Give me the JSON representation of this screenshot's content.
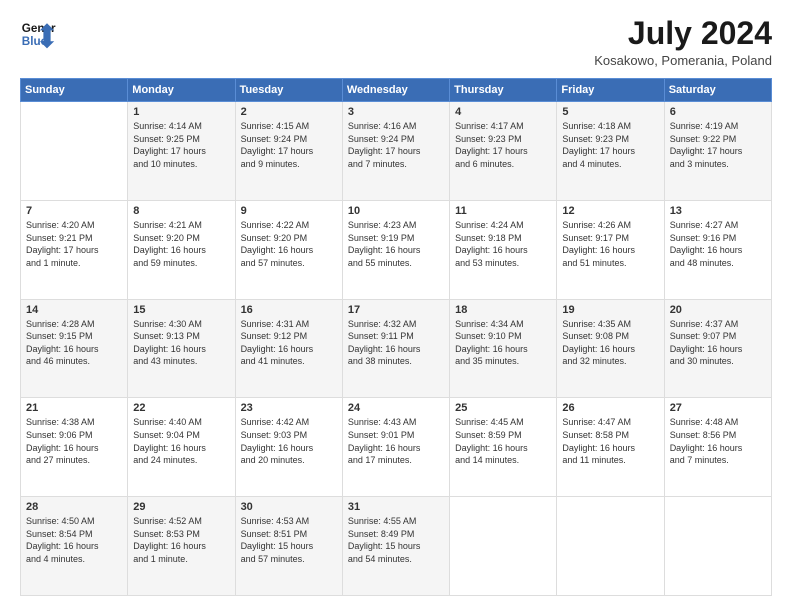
{
  "header": {
    "logo_line1": "General",
    "logo_line2": "Blue",
    "month_title": "July 2024",
    "location": "Kosakowo, Pomerania, Poland"
  },
  "weekdays": [
    "Sunday",
    "Monday",
    "Tuesday",
    "Wednesday",
    "Thursday",
    "Friday",
    "Saturday"
  ],
  "weeks": [
    [
      {
        "day": "",
        "text": ""
      },
      {
        "day": "1",
        "text": "Sunrise: 4:14 AM\nSunset: 9:25 PM\nDaylight: 17 hours\nand 10 minutes."
      },
      {
        "day": "2",
        "text": "Sunrise: 4:15 AM\nSunset: 9:24 PM\nDaylight: 17 hours\nand 9 minutes."
      },
      {
        "day": "3",
        "text": "Sunrise: 4:16 AM\nSunset: 9:24 PM\nDaylight: 17 hours\nand 7 minutes."
      },
      {
        "day": "4",
        "text": "Sunrise: 4:17 AM\nSunset: 9:23 PM\nDaylight: 17 hours\nand 6 minutes."
      },
      {
        "day": "5",
        "text": "Sunrise: 4:18 AM\nSunset: 9:23 PM\nDaylight: 17 hours\nand 4 minutes."
      },
      {
        "day": "6",
        "text": "Sunrise: 4:19 AM\nSunset: 9:22 PM\nDaylight: 17 hours\nand 3 minutes."
      }
    ],
    [
      {
        "day": "7",
        "text": "Sunrise: 4:20 AM\nSunset: 9:21 PM\nDaylight: 17 hours\nand 1 minute."
      },
      {
        "day": "8",
        "text": "Sunrise: 4:21 AM\nSunset: 9:20 PM\nDaylight: 16 hours\nand 59 minutes."
      },
      {
        "day": "9",
        "text": "Sunrise: 4:22 AM\nSunset: 9:20 PM\nDaylight: 16 hours\nand 57 minutes."
      },
      {
        "day": "10",
        "text": "Sunrise: 4:23 AM\nSunset: 9:19 PM\nDaylight: 16 hours\nand 55 minutes."
      },
      {
        "day": "11",
        "text": "Sunrise: 4:24 AM\nSunset: 9:18 PM\nDaylight: 16 hours\nand 53 minutes."
      },
      {
        "day": "12",
        "text": "Sunrise: 4:26 AM\nSunset: 9:17 PM\nDaylight: 16 hours\nand 51 minutes."
      },
      {
        "day": "13",
        "text": "Sunrise: 4:27 AM\nSunset: 9:16 PM\nDaylight: 16 hours\nand 48 minutes."
      }
    ],
    [
      {
        "day": "14",
        "text": "Sunrise: 4:28 AM\nSunset: 9:15 PM\nDaylight: 16 hours\nand 46 minutes."
      },
      {
        "day": "15",
        "text": "Sunrise: 4:30 AM\nSunset: 9:13 PM\nDaylight: 16 hours\nand 43 minutes."
      },
      {
        "day": "16",
        "text": "Sunrise: 4:31 AM\nSunset: 9:12 PM\nDaylight: 16 hours\nand 41 minutes."
      },
      {
        "day": "17",
        "text": "Sunrise: 4:32 AM\nSunset: 9:11 PM\nDaylight: 16 hours\nand 38 minutes."
      },
      {
        "day": "18",
        "text": "Sunrise: 4:34 AM\nSunset: 9:10 PM\nDaylight: 16 hours\nand 35 minutes."
      },
      {
        "day": "19",
        "text": "Sunrise: 4:35 AM\nSunset: 9:08 PM\nDaylight: 16 hours\nand 32 minutes."
      },
      {
        "day": "20",
        "text": "Sunrise: 4:37 AM\nSunset: 9:07 PM\nDaylight: 16 hours\nand 30 minutes."
      }
    ],
    [
      {
        "day": "21",
        "text": "Sunrise: 4:38 AM\nSunset: 9:06 PM\nDaylight: 16 hours\nand 27 minutes."
      },
      {
        "day": "22",
        "text": "Sunrise: 4:40 AM\nSunset: 9:04 PM\nDaylight: 16 hours\nand 24 minutes."
      },
      {
        "day": "23",
        "text": "Sunrise: 4:42 AM\nSunset: 9:03 PM\nDaylight: 16 hours\nand 20 minutes."
      },
      {
        "day": "24",
        "text": "Sunrise: 4:43 AM\nSunset: 9:01 PM\nDaylight: 16 hours\nand 17 minutes."
      },
      {
        "day": "25",
        "text": "Sunrise: 4:45 AM\nSunset: 8:59 PM\nDaylight: 16 hours\nand 14 minutes."
      },
      {
        "day": "26",
        "text": "Sunrise: 4:47 AM\nSunset: 8:58 PM\nDaylight: 16 hours\nand 11 minutes."
      },
      {
        "day": "27",
        "text": "Sunrise: 4:48 AM\nSunset: 8:56 PM\nDaylight: 16 hours\nand 7 minutes."
      }
    ],
    [
      {
        "day": "28",
        "text": "Sunrise: 4:50 AM\nSunset: 8:54 PM\nDaylight: 16 hours\nand 4 minutes."
      },
      {
        "day": "29",
        "text": "Sunrise: 4:52 AM\nSunset: 8:53 PM\nDaylight: 16 hours\nand 1 minute."
      },
      {
        "day": "30",
        "text": "Sunrise: 4:53 AM\nSunset: 8:51 PM\nDaylight: 15 hours\nand 57 minutes."
      },
      {
        "day": "31",
        "text": "Sunrise: 4:55 AM\nSunset: 8:49 PM\nDaylight: 15 hours\nand 54 minutes."
      },
      {
        "day": "",
        "text": ""
      },
      {
        "day": "",
        "text": ""
      },
      {
        "day": "",
        "text": ""
      }
    ]
  ]
}
